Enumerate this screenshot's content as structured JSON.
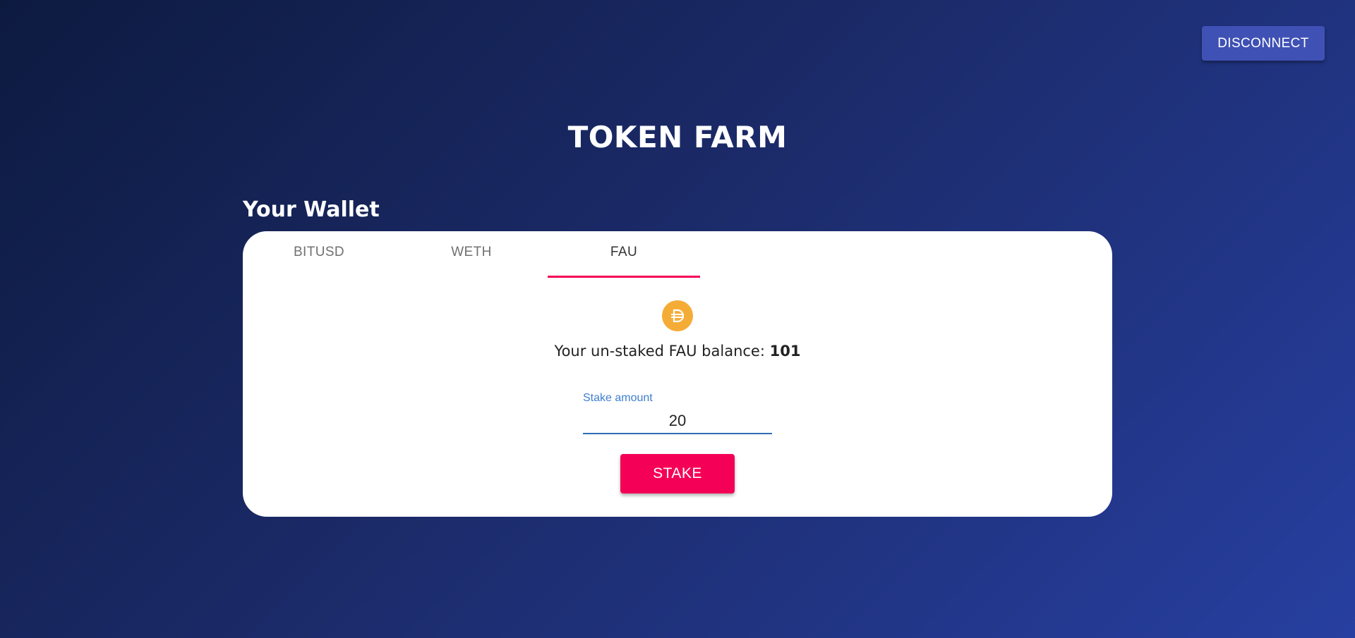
{
  "header": {
    "disconnect_label": "DISCONNECT"
  },
  "page": {
    "title": "TOKEN FARM"
  },
  "wallet": {
    "heading": "Your Wallet",
    "tabs": [
      {
        "label": "BITUSD",
        "active": false
      },
      {
        "label": "WETH",
        "active": false
      },
      {
        "label": "FAU",
        "active": true
      }
    ],
    "selected_token": {
      "icon": "dai-token-icon",
      "icon_color": "#f5ac37",
      "balance_prefix": "Your un-staked FAU balance: ",
      "balance_value": "101"
    },
    "stake": {
      "label": "Stake amount",
      "value": "20",
      "button_label": "STAKE"
    }
  },
  "colors": {
    "primary": "#3f51b5",
    "accent": "#f50057",
    "input_label": "#3f7ecf"
  }
}
